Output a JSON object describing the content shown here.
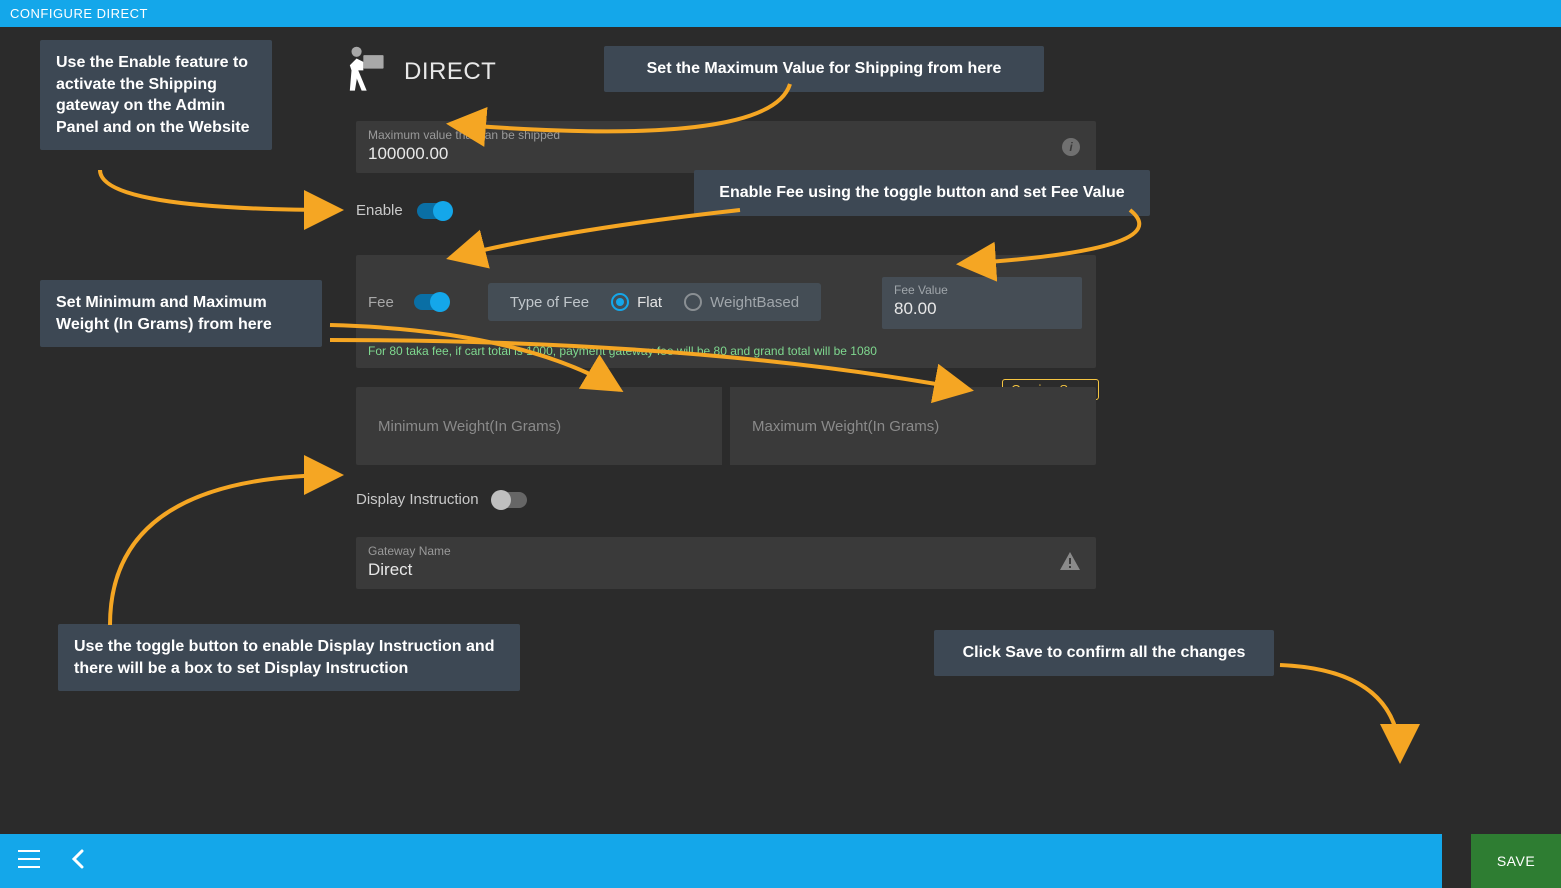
{
  "header": {
    "title": "CONFIGURE DIRECT"
  },
  "page": {
    "title": "DIRECT",
    "max_value": {
      "label": "Maximum value that can be shipped",
      "value": "100000.00"
    },
    "enable": {
      "label": "Enable",
      "on": true
    },
    "fee": {
      "label": "Fee",
      "on": true,
      "type_label": "Type of Fee",
      "options": {
        "flat": "Flat",
        "weight": "WeightBased"
      },
      "selected": "flat",
      "value_label": "Fee Value",
      "value": "80.00",
      "hint": "For 80 taka fee, if cart total is 1000, payment gateway fee will be 80 and grand total will be 1080"
    },
    "weight": {
      "min_placeholder": "Minimum Weight(In Grams)",
      "max_placeholder": "Maximum Weight(In Grams)",
      "coming_soon": "Coming Soon"
    },
    "display_instruction": {
      "label": "Display Instruction",
      "on": false
    },
    "gateway": {
      "label": "Gateway Name",
      "value": "Direct"
    }
  },
  "footer": {
    "save": "SAVE"
  },
  "callouts": {
    "enable_hint": "Use the Enable feature to activate the Shipping gateway on the Admin Panel and on the Website",
    "max_value_hint": "Set the Maximum Value for Shipping from here",
    "fee_hint": "Enable Fee using the toggle button and set Fee Value",
    "weight_hint": "Set Minimum and Maximum Weight (In Grams) from here",
    "display_hint": "Use the toggle button to enable Display Instruction and there will be a box to set Display Instruction",
    "save_hint": "Click Save to confirm all the changes"
  }
}
